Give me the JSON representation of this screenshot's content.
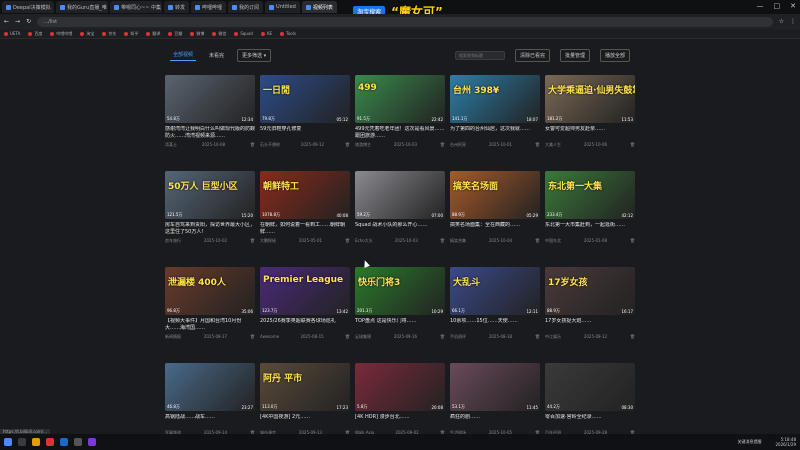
{
  "browser": {
    "tabs": [
      {
        "title": "Deepal决策模拟"
      },
      {
        "title": "我的Guru直播_唯"
      },
      {
        "title": "带嗯同心~~ 中集"
      },
      {
        "title": "转发"
      },
      {
        "title": "哔哩哔哩"
      },
      {
        "title": "我的订阅"
      },
      {
        "title": "Untitled"
      },
      {
        "title": "视频列表"
      }
    ],
    "url": "…/list",
    "banner_button": "淘宝搜索",
    "banner_text": "“魔女可”",
    "bookmarks": [
      "UETA",
      "百度",
      "哔哩哔哩",
      "淘宝",
      "京东",
      "知乎",
      "翻译",
      "豆瓣",
      "微博",
      "微信",
      "Squad",
      "KE",
      "Tools"
    ]
  },
  "toolbar": {
    "tabs": [
      "全部视频",
      "未看完"
    ],
    "active_tab": "全部视频",
    "filter_label": "更多筛选",
    "search_placeholder": "搜索视频标题",
    "clear_button": "清除已看完",
    "manage_button": "批量管理",
    "play_all_button": "播放全部"
  },
  "videos": [
    {
      "title": "感谢湾湾让我明白什么叫做现代版的防鳗防火……湾湾视频来源……",
      "duration": "12:34",
      "views": "54.8万",
      "uploader": "湾某士",
      "date": "2025-10-08",
      "overlay": "",
      "bg": "#5a6470"
    },
    {
      "title": "59元旧鞋穿孔修复",
      "duration": "05:12",
      "views": "79.8万",
      "uploader": "石头不想修",
      "date": "2025-09-12",
      "overlay": "一日閒",
      "bg": "#2d4c88"
    },
    {
      "title": "499元凭着吃老年团！这次是看风景……跟团旅游……",
      "duration": "22:42",
      "views": "91.5万",
      "uploader": "旅游博主",
      "date": "2025-10-03",
      "overlay": "499",
      "bg": "#3a8a4c"
    },
    {
      "title": "为了第四的台州仙居，这次我就……",
      "duration": "18:07",
      "views": "141.1万",
      "uploader": "台州阿亮",
      "date": "2025-10-01",
      "overlay": "台州 398¥",
      "bg": "#2b7fa8"
    },
    {
      "title": "女警可爱超帅男友赴亲……",
      "duration": "11:53",
      "views": "181.2万",
      "uploader": "大美人生",
      "date": "2025-10-06",
      "overlay": "大学乘逼迫·仙男失鼓掌",
      "bg": "#7a6a55"
    },
    {
      "title": "房车自驾来到贵阳，探访世界最大小区，这里住了50万人！",
      "duration": "15:20",
      "views": "121.5万",
      "uploader": "房车旅行",
      "date": "2025-10-02",
      "overlay": "50万人 巨型小区",
      "bg": "#556677"
    },
    {
      "title": "在朝鲜，如何说着一看到工……朝鲜朝鲜……",
      "duration": "40:08",
      "views": "1078.8万",
      "uploader": "大鹏探秘",
      "date": "2025-05-01",
      "overlay": "朝鲜特工",
      "bg": "#8a2a1a"
    },
    {
      "title": "Squad 战术小队的那么开心……",
      "duration": "07:00",
      "views": "59.2万",
      "uploader": "Echo大头",
      "date": "2025-10-03",
      "overlay": "",
      "bg": "#8a8a90"
    },
    {
      "title": "搞笑名场面集：全在西藏的……",
      "duration": "05:29",
      "views": "88.9万",
      "uploader": "搞笑合集",
      "date": "2025-10-04",
      "overlay": "搞笑名场面",
      "bg": "#a85a2a"
    },
    {
      "title": "东北第一大市集赶到，一起逛街……",
      "duration": "42:12",
      "views": "233.4万",
      "uploader": "中国东北",
      "date": "2025-01-08",
      "overlay": "东北第一大集",
      "bg": "#3a7a3a"
    },
    {
      "title": "【视频大事件】月国和台湾10月份大……海湾国……",
      "duration": "35:06",
      "views": "96.8万",
      "uploader": "新闻情报",
      "date": "2025-08-17",
      "overlay": "泄漏楼 400人",
      "bg": "#6a3a2a"
    },
    {
      "title": "2025/26赛季英超联赛各球场巡礼",
      "duration": "13:42",
      "views": "123.7万",
      "uploader": "Awesome",
      "date": "2025-08-15",
      "overlay": "Premier League",
      "bg": "#4a2a7a"
    },
    {
      "title": "TOP盘点 这是快乐门将……",
      "duration": "10:29",
      "views": "201.3万",
      "uploader": "足球集锦",
      "date": "2025-09-16",
      "overlay": "快乐门将3",
      "bg": "#2a7a2a"
    },
    {
      "title": "10余项……15位……天使……",
      "duration": "12:11",
      "views": "66.1万",
      "uploader": "手机测评",
      "date": "2025-08-18",
      "overlay": "大乱斗",
      "bg": "#3a4a8a"
    },
    {
      "title": "17岁女孩捉大炮……",
      "duration": "16:17",
      "views": "88.9万",
      "uploader": "中江娱乐",
      "date": "2025-08-12",
      "overlay": "17岁女孩",
      "bg": "#4a3a3a"
    },
    {
      "title": "高钢陆战……战车……",
      "duration": "23:27",
      "views": "46.8万",
      "uploader": "军事频道",
      "date": "2025-09-14",
      "overlay": "",
      "bg": "#4a6a8a"
    },
    {
      "title": "[4K中国夜游] 2元……",
      "duration": "17:23",
      "views": "113.0万",
      "uploader": "城市漫步",
      "date": "2025-09-13",
      "overlay": "阿丹 平市",
      "bg": "#5a4a3a"
    },
    {
      "title": "[4K HDR] 漫步台北……",
      "duration": "20:08",
      "views": "5.8万",
      "uploader": "Walk Asia",
      "date": "2025-09-02",
      "overlay": "",
      "bg": "#7a2a3a"
    },
    {
      "title": "疯狂的剧……",
      "duration": "11:45",
      "views": "53.1万",
      "uploader": "生活剧场",
      "date": "2025-10-05",
      "overlay": "",
      "bg": "#6a4a5a"
    },
    {
      "title": "零百加速·宫岭全纪录……",
      "duration": "08:30",
      "views": "44.2万",
      "uploader": "汽车评测",
      "date": "2025-09-28",
      "overlay": "",
      "bg": "#3a3a3a"
    }
  ],
  "status_url": "https://t.bilibili.com/...",
  "taskbar": {
    "time": "5:18:48",
    "date": "2026/1/29",
    "tray_text": "关键消息提醒"
  }
}
